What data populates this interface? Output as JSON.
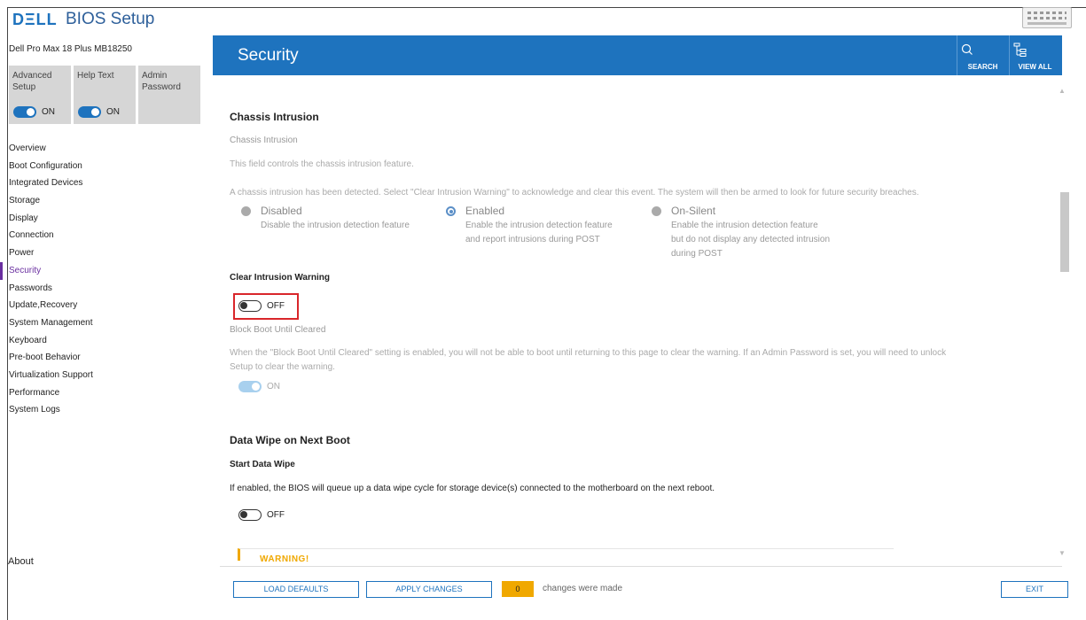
{
  "header": {
    "logo": "DΞLL",
    "title": "BIOS Setup",
    "model": "Dell Pro Max 18 Plus MB18250"
  },
  "tiles": [
    {
      "label": "Advanced Setup",
      "state": "ON"
    },
    {
      "label": "Help Text",
      "state": "ON"
    },
    {
      "label": "Admin Password"
    }
  ],
  "sidebar": {
    "items": [
      {
        "label": "Overview"
      },
      {
        "label": "Boot Configuration"
      },
      {
        "label": "Integrated Devices"
      },
      {
        "label": "Storage"
      },
      {
        "label": "Display"
      },
      {
        "label": "Connection"
      },
      {
        "label": "Power"
      },
      {
        "label": "Security",
        "active": true
      },
      {
        "label": "Passwords"
      },
      {
        "label": "Update,Recovery"
      },
      {
        "label": "System Management"
      },
      {
        "label": "Keyboard"
      },
      {
        "label": "Pre-boot Behavior"
      },
      {
        "label": "Virtualization Support"
      },
      {
        "label": "Performance"
      },
      {
        "label": "System Logs"
      }
    ],
    "about": "About"
  },
  "banner": {
    "title": "Security",
    "search_label": "SEARCH",
    "viewall_label": "VIEW ALL",
    "color": "#1e73be"
  },
  "chassis": {
    "section_title": "Chassis Intrusion",
    "setting_title": "Chassis Intrusion",
    "desc": "This field controls the chassis intrusion feature.",
    "detected": "A chassis intrusion has been detected.  Select \"Clear Intrusion Warning\" to acknowledge and clear this event.  The system will then be armed to look for future security breaches.",
    "options": [
      {
        "label": "Disabled",
        "desc1": "Disable the intrusion detection feature",
        "desc2": "",
        "desc3": ""
      },
      {
        "label": "Enabled",
        "desc1": "Enable the intrusion detection feature",
        "desc2": "and report intrusions during POST",
        "desc3": "",
        "selected": true
      },
      {
        "label": "On-Silent",
        "desc1": "Enable the intrusion detection feature",
        "desc2": "but do not display any detected intrusion",
        "desc3": "during POST"
      }
    ]
  },
  "clear_warning": {
    "title": "Clear Intrusion Warning",
    "state": "OFF"
  },
  "block_boot": {
    "title": "Block Boot Until Cleared",
    "desc1": "When the \"Block Boot Until Cleared\" setting is enabled, you will not be able to boot until returning to this page to clear the warning. If an Admin Password is set, you will need to unlock",
    "desc2": "Setup to clear the warning.",
    "state": "ON"
  },
  "data_wipe": {
    "section_title": "Data Wipe on Next Boot",
    "setting_title": "Start Data Wipe",
    "desc": "If enabled, the BIOS will queue up a data wipe cycle for storage device(s) connected to the motherboard on the next reboot.",
    "state": "OFF",
    "warning": "WARNING!"
  },
  "footer": {
    "load_defaults": "LOAD DEFAULTS",
    "apply_changes": "APPLY CHANGES",
    "change_count": "0",
    "changes_text": "changes were made",
    "exit": "EXIT",
    "badge_color": "#f0a800"
  }
}
